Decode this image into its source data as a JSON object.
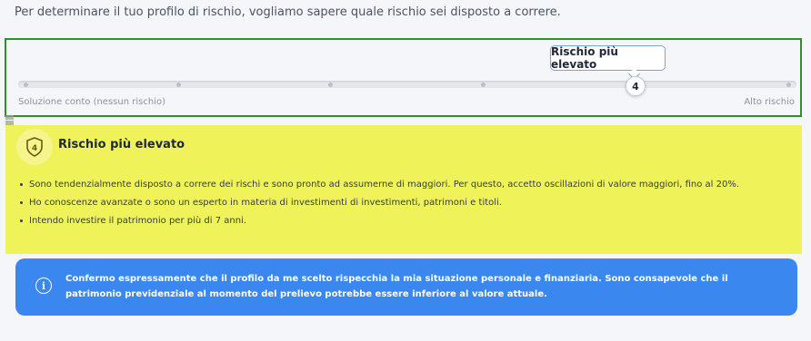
{
  "intro": "Per determinare il tuo profilo di rischio, vogliamo sapere quale rischio sei disposto a correre.",
  "slider": {
    "tooltip": "Rischio più elevato",
    "current_value": "4",
    "levels": 5,
    "selected_level": 4,
    "min_label": "Soluzione conto (nessun rischio)",
    "max_label": "Alto rischio"
  },
  "profile": {
    "badge_value": "4",
    "title": "Rischio più elevato",
    "bullets": [
      "Sono tendenzialmente disposto a correre dei rischi e sono pronto ad assumerne di maggiori. Per questo, accetto oscillazioni di valore maggiori, fino al 20%.",
      "Ho conoscenze avanzate o sono un esperto in materia di investimenti di investimenti, patrimoni e titoli.",
      "Intendo investire il patrimonio per più di 7 anni."
    ],
    "background_color": "#f0f25a"
  },
  "info": {
    "icon": "info-icon",
    "text": "Confermo espressamente che il profilo da me scelto rispecchia la mia situazione personale e finanziaria. Sono consapevole che il patrimonio previdenziale al momento del prelievo potrebbe essere inferiore al valore attuale.",
    "background_color": "#3b87f0"
  }
}
